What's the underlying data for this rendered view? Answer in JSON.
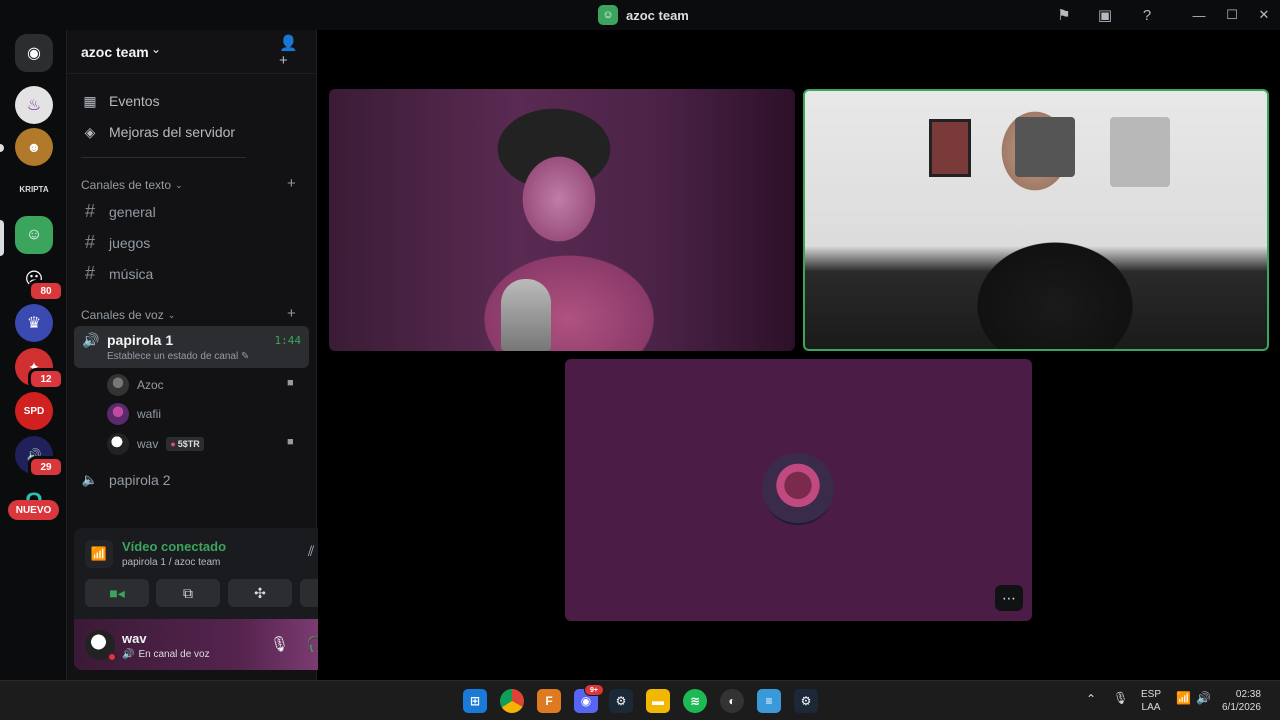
{
  "window": {
    "title": "azoc team",
    "minimize_glyph": "—",
    "maximize_glyph": "☐",
    "close_glyph": "✕"
  },
  "rail": {
    "badges": [
      "80",
      "12",
      "29"
    ],
    "new_label": "NUEVO"
  },
  "server": {
    "name": "azoc team",
    "events_label": "Eventos",
    "boosts_label": "Mejoras del servidor",
    "text_category": "Canales de texto",
    "voice_category": "Canales de voz",
    "text_channels": [
      "general",
      "juegos",
      "música"
    ],
    "active_voice": {
      "name": "papirola 1",
      "timer": "1:44",
      "status": "Establece un estado de canal"
    },
    "voice_users": [
      {
        "name": "Azoc"
      },
      {
        "name": "wafii"
      },
      {
        "name": "wav",
        "tag": "5$TR"
      }
    ],
    "other_voice": "papirola 2"
  },
  "voice_panel": {
    "title": "Vídeo conectado",
    "subtitle": "papirola 1 / azoc team"
  },
  "user": {
    "name": "wav",
    "status": "En canal de voz"
  },
  "tray": {
    "lang_line1": "ESP",
    "lang_line2": "LAA",
    "time": "02:38",
    "date": "6/1/2026",
    "discord_badge": "9+"
  },
  "colors": {
    "accent_green": "#3ba55d",
    "danger_red": "#da373c",
    "sidebar_bg": "#121214"
  }
}
